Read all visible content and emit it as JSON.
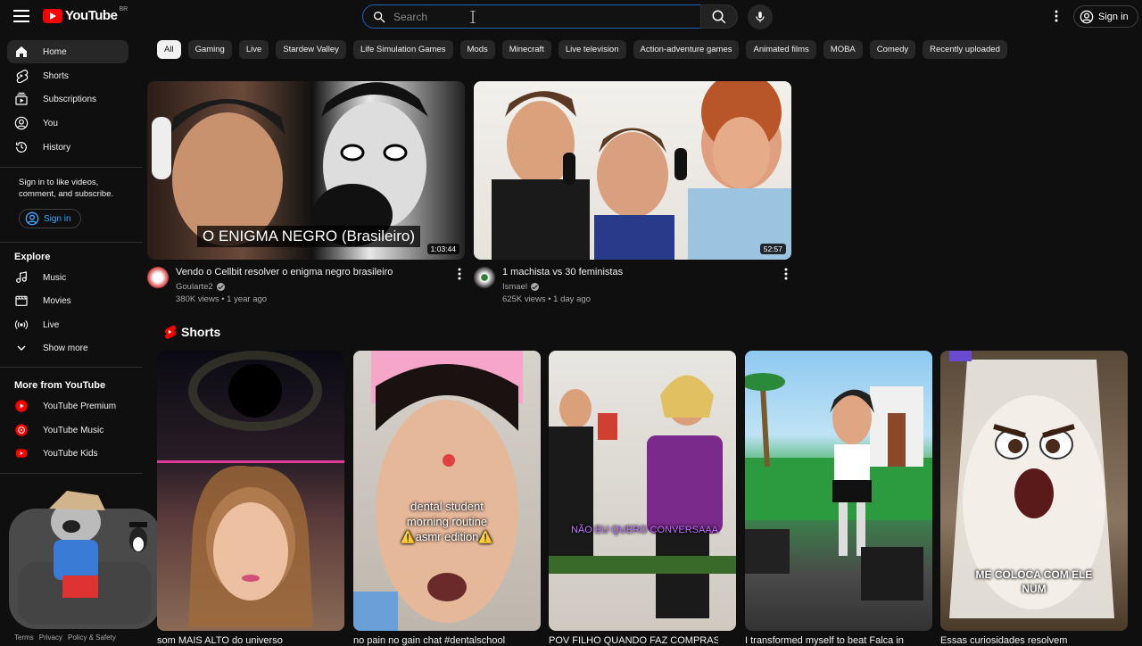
{
  "header": {
    "logo_text": "YouTube",
    "country_code": "BR",
    "search_placeholder": "Search",
    "signin_label": "Sign in"
  },
  "sidebar": {
    "main_items": [
      {
        "label": "Home",
        "icon": "home-icon",
        "active": true
      },
      {
        "label": "Shorts",
        "icon": "shorts-icon"
      },
      {
        "label": "Subscriptions",
        "icon": "subscriptions-icon"
      },
      {
        "label": "You",
        "icon": "you-icon"
      },
      {
        "label": "History",
        "icon": "history-icon"
      }
    ],
    "signin_prompt": "Sign in to like videos, comment, and subscribe.",
    "signin_button": "Sign in",
    "explore_heading": "Explore",
    "explore_items": [
      {
        "label": "Music",
        "icon": "music-icon"
      },
      {
        "label": "Movies",
        "icon": "movies-icon"
      },
      {
        "label": "Live",
        "icon": "live-icon"
      },
      {
        "label": "Show more",
        "icon": "chevron-down-icon"
      }
    ],
    "more_heading": "More from YouTube",
    "more_items": [
      {
        "label": "YouTube Premium",
        "icon": "youtube-premium-icon"
      },
      {
        "label": "YouTube Music",
        "icon": "youtube-music-icon"
      },
      {
        "label": "YouTube Kids",
        "icon": "youtube-kids-icon"
      }
    ],
    "footer_links": [
      "Terms",
      "Privacy",
      "Policy & Safety"
    ]
  },
  "chips": [
    "All",
    "Gaming",
    "Live",
    "Stardew Valley",
    "Life Simulation Games",
    "Mods",
    "Minecraft",
    "Live television",
    "Action-adventure games",
    "Animated films",
    "MOBA",
    "Comedy",
    "Recently uploaded"
  ],
  "videos": [
    {
      "title": "Vendo o Cellbit resolver o enigma negro brasileiro",
      "channel": "Goularte2",
      "stats": "380K views • 1 year ago",
      "duration": "1:03:44",
      "thumb_caption": "O ENIGMA NEGRO (Brasileiro)"
    },
    {
      "title": "1 machista vs 30 feministas",
      "channel": "Ismael",
      "stats": "625K views • 1 day ago",
      "duration": "52:57",
      "thumb_caption": ""
    }
  ],
  "shorts_heading": "Shorts",
  "shorts": [
    {
      "title": "som MAIS ALTO do universo",
      "caption": ""
    },
    {
      "title": "no pain no gain chat #dentalschool",
      "caption": "dental student morning routine ⚠️asmr edition⚠️"
    },
    {
      "title": "POV FILHO QUANDO FAZ COMPRAS",
      "caption": "NÃO EU QUERO CONVERSAAA"
    },
    {
      "title": "I transformed myself to beat Falca in",
      "caption": ""
    },
    {
      "title": "Essas curiosidades resolvem",
      "caption": "ME COLOCA COM ELE NUM"
    }
  ]
}
